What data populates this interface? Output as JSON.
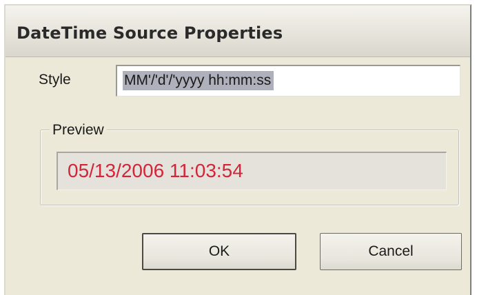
{
  "window": {
    "title": "DateTime Source Properties"
  },
  "style": {
    "label": "Style",
    "value": "MM'/'d'/'yyyy hh:mm:ss"
  },
  "preview": {
    "legend": "Preview",
    "value": "05/13/2006 11:03:54",
    "value_color": "#d4243a"
  },
  "buttons": {
    "ok_label": "OK",
    "cancel_label": "Cancel"
  }
}
